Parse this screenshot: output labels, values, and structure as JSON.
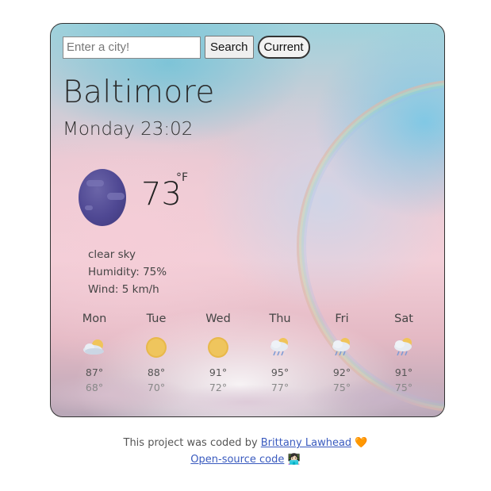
{
  "search": {
    "placeholder": "Enter a city!",
    "value": "",
    "search_label": "Search",
    "current_label": "Current"
  },
  "current": {
    "city": "Baltimore",
    "datetime": "Monday 23:02",
    "icon": "moon-icon",
    "temperature": "73",
    "unit": "°F",
    "description": "clear sky",
    "humidity": "Humidity: 75%",
    "wind": "Wind: 5 km/h"
  },
  "forecast": [
    {
      "day": "Mon",
      "icon": "partly-cloudy-icon",
      "max": "87°",
      "min": "68°"
    },
    {
      "day": "Tue",
      "icon": "sun-icon",
      "max": "88°",
      "min": "70°"
    },
    {
      "day": "Wed",
      "icon": "sun-icon",
      "max": "91°",
      "min": "72°"
    },
    {
      "day": "Thu",
      "icon": "rain-cloud-icon",
      "max": "95°",
      "min": "77°"
    },
    {
      "day": "Fri",
      "icon": "rain-cloud-icon",
      "max": "92°",
      "min": "75°"
    },
    {
      "day": "Sat",
      "icon": "rain-cloud-icon",
      "max": "91°",
      "min": "75°"
    }
  ],
  "footer": {
    "credit_prefix": "This project was coded by ",
    "author": "Brittany Lawhead",
    "heart": "🧡",
    "source_link": "Open-source code",
    "source_emoji": "👩🏻‍💻"
  },
  "colors": {
    "moon": "#4f4893",
    "sun": "#e8b84a",
    "link": "#3a5bbf"
  }
}
